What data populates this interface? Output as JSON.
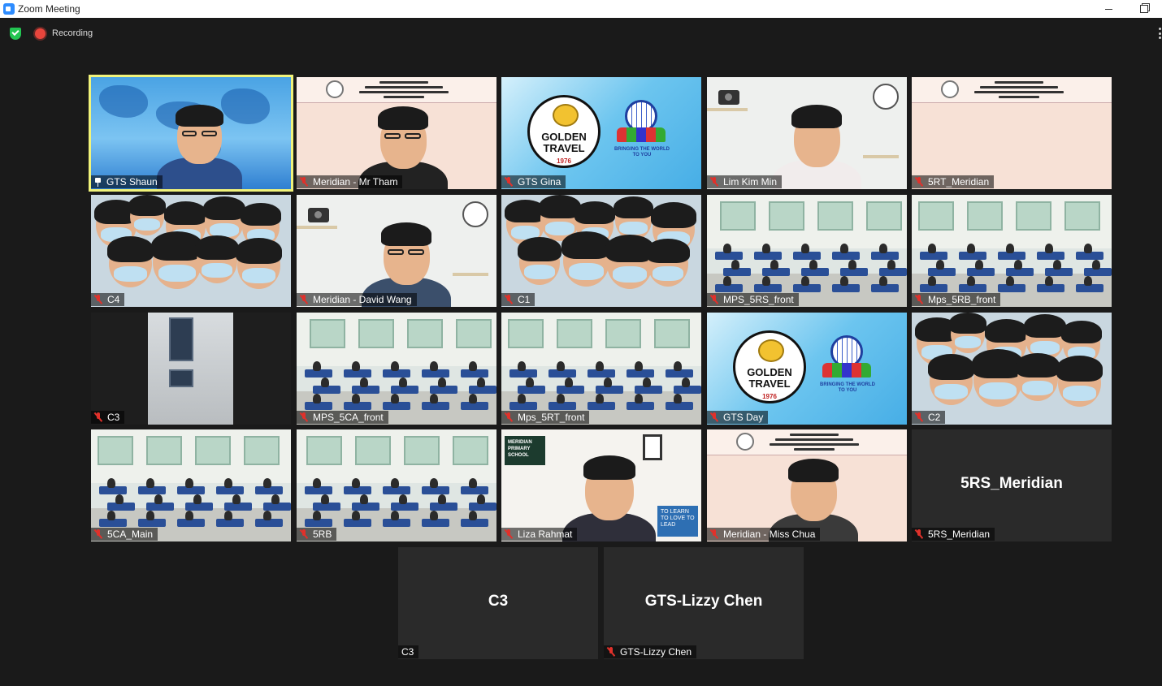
{
  "window": {
    "title": "Zoom Meeting"
  },
  "status": {
    "recording_label": "Recording"
  },
  "colors": {
    "active_speaker_border": "#f1f37a",
    "muted_mic": "#e0312b",
    "recording_dot": "#e8453c",
    "encryption_shield": "#23c552",
    "background": "#1a1a1a"
  },
  "participants": [
    {
      "name": "GTS Shaun",
      "icon": "pin-icon",
      "active": true,
      "scene": "map"
    },
    {
      "name": "Meridian - Mr Tham",
      "icon": "mic-off-icon",
      "scene": "slide-person"
    },
    {
      "name": "GTS Gina",
      "icon": "mic-off-icon",
      "scene": "golden-travel"
    },
    {
      "name": "Lim Kim Min",
      "icon": "mic-off-icon",
      "scene": "room-person"
    },
    {
      "name": "5RT_Meridian",
      "icon": "mic-off-icon",
      "scene": "slide"
    },
    {
      "name": "C4",
      "icon": "mic-off-icon",
      "scene": "kids"
    },
    {
      "name": "Meridian - David Wang",
      "icon": "mic-off-icon",
      "scene": "room-person"
    },
    {
      "name": "C1",
      "icon": "mic-off-icon",
      "scene": "kids"
    },
    {
      "name": "MPS_5RS_front",
      "icon": "mic-off-icon",
      "scene": "classroom"
    },
    {
      "name": "Mps_5RB_front",
      "icon": "mic-off-icon",
      "scene": "classroom"
    },
    {
      "name": "C3",
      "icon": "mic-off-icon",
      "scene": "door"
    },
    {
      "name": "MPS_5CA_front",
      "icon": "mic-off-icon",
      "scene": "classroom"
    },
    {
      "name": "Mps_5RT_front",
      "icon": "mic-off-icon",
      "scene": "classroom"
    },
    {
      "name": "GTS Day",
      "icon": "mic-off-icon",
      "scene": "golden-travel"
    },
    {
      "name": "C2",
      "icon": "mic-off-icon",
      "scene": "kids"
    },
    {
      "name": "5CA_Main",
      "icon": "mic-off-icon",
      "scene": "classroom"
    },
    {
      "name": "5RB",
      "icon": "mic-off-icon",
      "scene": "classroom"
    },
    {
      "name": "Liza Rahmat",
      "icon": "mic-off-icon",
      "scene": "liza"
    },
    {
      "name": "Meridian - Miss Chua",
      "icon": "mic-off-icon",
      "scene": "slide-person"
    },
    {
      "name": "5RS_Meridian",
      "icon": "mic-off-icon",
      "scene": "blank",
      "display_name": "5RS_Meridian"
    },
    {
      "name": "C3",
      "icon": "none",
      "scene": "blank",
      "display_name": "C3"
    },
    {
      "name": "GTS-Lizzy Chen",
      "icon": "mic-off-icon",
      "scene": "blank",
      "display_name": "GTS-Lizzy Chen"
    }
  ],
  "slide_text": {
    "meridian_header_1": "Meridian Primary School",
    "science_header": "Science Department & ALP",
    "trip_title": "P5 Virtual Overseas Immersion Trips 2022",
    "session_label": "Sharing Session"
  },
  "golden_travel": {
    "brand": "GOLDEN TRAVEL",
    "since": "1976",
    "tagline": "BRINGING THE WORLD TO YOU"
  },
  "liza_room": {
    "board_text": "MERIDIAN PRIMARY SCHOOL",
    "poster_text": "TO LEARN TO LOVE TO LEAD"
  }
}
